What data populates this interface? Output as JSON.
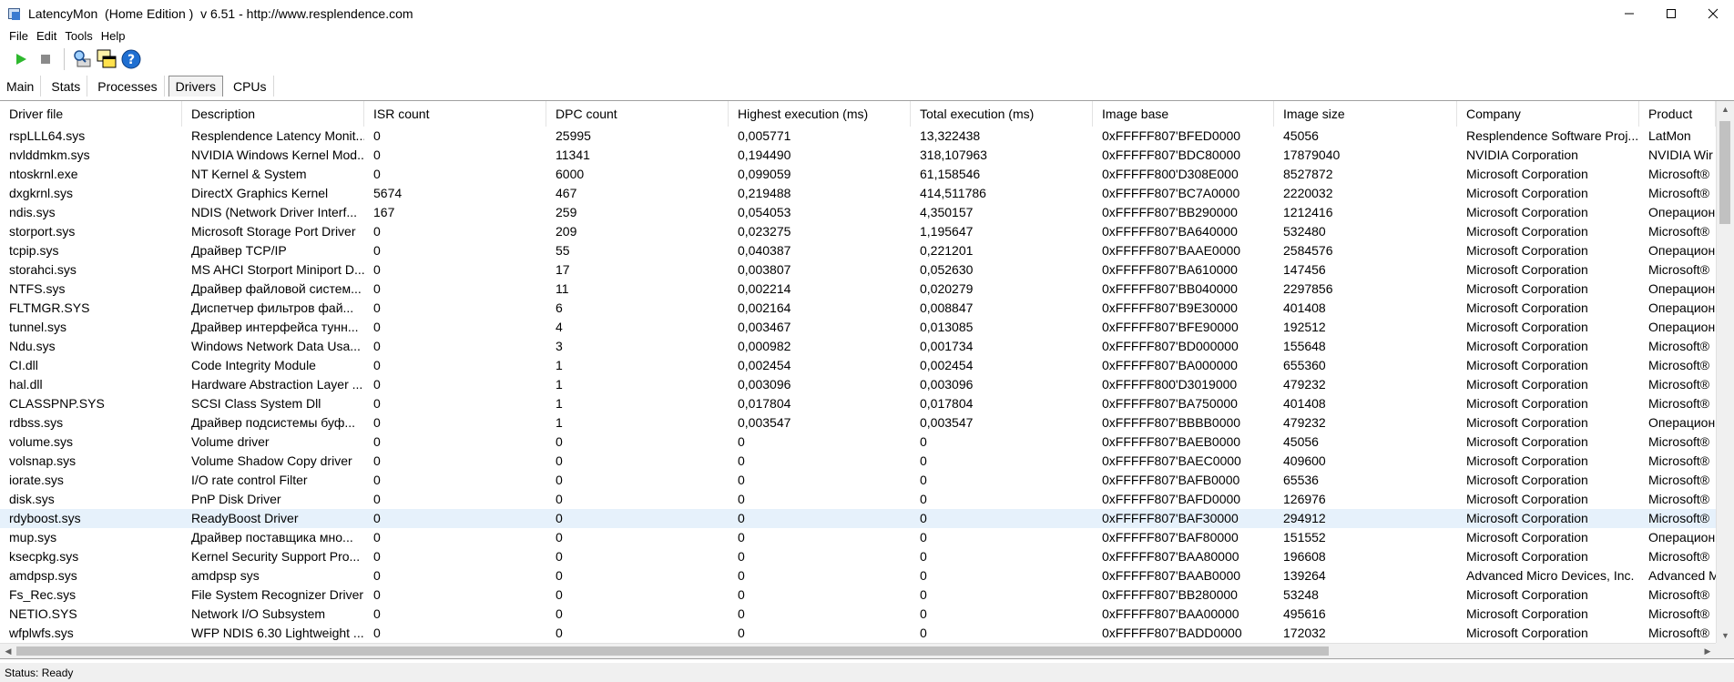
{
  "window": {
    "title": "LatencyMon  (Home Edition )  v 6.51 - http://www.resplendence.com"
  },
  "menu": [
    {
      "label": "File"
    },
    {
      "label": "Edit"
    },
    {
      "label": "Tools"
    },
    {
      "label": "Help"
    }
  ],
  "toolbar": {
    "icons": [
      "play-icon",
      "stop-icon",
      "search-computer-icon",
      "windows-icon",
      "help-icon"
    ]
  },
  "tabs": [
    {
      "label": "Main"
    },
    {
      "label": "Stats"
    },
    {
      "label": "Processes"
    },
    {
      "label": "Drivers",
      "active": true
    },
    {
      "label": "CPUs"
    }
  ],
  "table": {
    "columns": [
      "Driver file",
      "Description",
      "ISR count",
      "DPC count",
      "Highest execution (ms)",
      "Total execution (ms)",
      "Image base",
      "Image size",
      "Company",
      "Product"
    ],
    "rows": [
      [
        "rspLLL64.sys",
        "Resplendence Latency Monit...",
        "0",
        "25995",
        "0,005771",
        "13,322438",
        "0xFFFFF807'BFED0000",
        "45056",
        "Resplendence Software Proj...",
        "LatMon"
      ],
      [
        "nvlddmkm.sys",
        "NVIDIA Windows Kernel Mod...",
        "0",
        "11341",
        "0,194490",
        "318,107963",
        "0xFFFFF807'BDC80000",
        "17879040",
        "NVIDIA Corporation",
        "NVIDIA Wir"
      ],
      [
        "ntoskrnl.exe",
        "NT Kernel & System",
        "0",
        "6000",
        "0,099059",
        "61,158546",
        "0xFFFFF800'D308E000",
        "8527872",
        "Microsoft Corporation",
        "Microsoft®"
      ],
      [
        "dxgkrnl.sys",
        "DirectX Graphics Kernel",
        "5674",
        "467",
        "0,219488",
        "414,511786",
        "0xFFFFF807'BC7A0000",
        "2220032",
        "Microsoft Corporation",
        "Microsoft®"
      ],
      [
        "ndis.sys",
        "NDIS (Network Driver Interf...",
        "167",
        "259",
        "0,054053",
        "4,350157",
        "0xFFFFF807'BB290000",
        "1212416",
        "Microsoft Corporation",
        "Операцион"
      ],
      [
        "storport.sys",
        "Microsoft Storage Port Driver",
        "0",
        "209",
        "0,023275",
        "1,195647",
        "0xFFFFF807'BA640000",
        "532480",
        "Microsoft Corporation",
        "Microsoft®"
      ],
      [
        "tcpip.sys",
        "Драйвер TCP/IP",
        "0",
        "55",
        "0,040387",
        "0,221201",
        "0xFFFFF807'BAAE0000",
        "2584576",
        "Microsoft Corporation",
        "Операцион"
      ],
      [
        "storahci.sys",
        "MS AHCI Storport Miniport D...",
        "0",
        "17",
        "0,003807",
        "0,052630",
        "0xFFFFF807'BA610000",
        "147456",
        "Microsoft Corporation",
        "Microsoft®"
      ],
      [
        "NTFS.sys",
        "Драйвер файловой систем...",
        "0",
        "11",
        "0,002214",
        "0,020279",
        "0xFFFFF807'BB040000",
        "2297856",
        "Microsoft Corporation",
        "Операцион"
      ],
      [
        "FLTMGR.SYS",
        "Диспетчер фильтров фай...",
        "0",
        "6",
        "0,002164",
        "0,008847",
        "0xFFFFF807'B9E30000",
        "401408",
        "Microsoft Corporation",
        "Операцион"
      ],
      [
        "tunnel.sys",
        "Драйвер интерфейса тунн...",
        "0",
        "4",
        "0,003467",
        "0,013085",
        "0xFFFFF807'BFE90000",
        "192512",
        "Microsoft Corporation",
        "Операцион"
      ],
      [
        "Ndu.sys",
        "Windows Network Data Usa...",
        "0",
        "3",
        "0,000982",
        "0,001734",
        "0xFFFFF807'BD000000",
        "155648",
        "Microsoft Corporation",
        "Microsoft®"
      ],
      [
        "CI.dll",
        "Code Integrity Module",
        "0",
        "1",
        "0,002454",
        "0,002454",
        "0xFFFFF807'BA000000",
        "655360",
        "Microsoft Corporation",
        "Microsoft®"
      ],
      [
        "hal.dll",
        "Hardware Abstraction Layer ...",
        "0",
        "1",
        "0,003096",
        "0,003096",
        "0xFFFFF800'D3019000",
        "479232",
        "Microsoft Corporation",
        "Microsoft®"
      ],
      [
        "CLASSPNP.SYS",
        "SCSI Class System Dll",
        "0",
        "1",
        "0,017804",
        "0,017804",
        "0xFFFFF807'BA750000",
        "401408",
        "Microsoft Corporation",
        "Microsoft®"
      ],
      [
        "rdbss.sys",
        "Драйвер подсистемы буф...",
        "0",
        "1",
        "0,003547",
        "0,003547",
        "0xFFFFF807'BBBB0000",
        "479232",
        "Microsoft Corporation",
        "Операцион"
      ],
      [
        "volume.sys",
        "Volume driver",
        "0",
        "0",
        "0",
        "0",
        "0xFFFFF807'BAEB0000",
        "45056",
        "Microsoft Corporation",
        "Microsoft®"
      ],
      [
        "volsnap.sys",
        "Volume Shadow Copy driver",
        "0",
        "0",
        "0",
        "0",
        "0xFFFFF807'BAEC0000",
        "409600",
        "Microsoft Corporation",
        "Microsoft®"
      ],
      [
        "iorate.sys",
        "I/O rate control Filter",
        "0",
        "0",
        "0",
        "0",
        "0xFFFFF807'BAFB0000",
        "65536",
        "Microsoft Corporation",
        "Microsoft®"
      ],
      [
        "disk.sys",
        "PnP Disk Driver",
        "0",
        "0",
        "0",
        "0",
        "0xFFFFF807'BAFD0000",
        "126976",
        "Microsoft Corporation",
        "Microsoft®"
      ],
      [
        "rdyboost.sys",
        "ReadyBoost Driver",
        "0",
        "0",
        "0",
        "0",
        "0xFFFFF807'BAF30000",
        "294912",
        "Microsoft Corporation",
        "Microsoft®"
      ],
      [
        "mup.sys",
        "Драйвер поставщика мно...",
        "0",
        "0",
        "0",
        "0",
        "0xFFFFF807'BAF80000",
        "151552",
        "Microsoft Corporation",
        "Операцион"
      ],
      [
        "ksecpkg.sys",
        "Kernel Security Support Pro...",
        "0",
        "0",
        "0",
        "0",
        "0xFFFFF807'BAA80000",
        "196608",
        "Microsoft Corporation",
        "Microsoft®"
      ],
      [
        "amdpsp.sys",
        "amdpsp sys",
        "0",
        "0",
        "0",
        "0",
        "0xFFFFF807'BAAB0000",
        "139264",
        "Advanced Micro Devices, Inc.",
        "Advanced M"
      ],
      [
        "Fs_Rec.sys",
        "File System Recognizer Driver",
        "0",
        "0",
        "0",
        "0",
        "0xFFFFF807'BB280000",
        "53248",
        "Microsoft Corporation",
        "Microsoft®"
      ],
      [
        "NETIO.SYS",
        "Network I/O Subsystem",
        "0",
        "0",
        "0",
        "0",
        "0xFFFFF807'BAA00000",
        "495616",
        "Microsoft Corporation",
        "Microsoft®"
      ],
      [
        "wfplwfs.sys",
        "WFP NDIS 6.30 Lightweight ...",
        "0",
        "0",
        "0",
        "0",
        "0xFFFFF807'BADD0000",
        "172032",
        "Microsoft Corporation",
        "Microsoft®"
      ]
    ],
    "selected_row": 20
  },
  "status": {
    "text": "Status: Ready"
  },
  "colors": {
    "selected_row_bg": "#e6f1fb",
    "play_green": "#2eb82e",
    "help_blue": "#1f6fd1"
  }
}
